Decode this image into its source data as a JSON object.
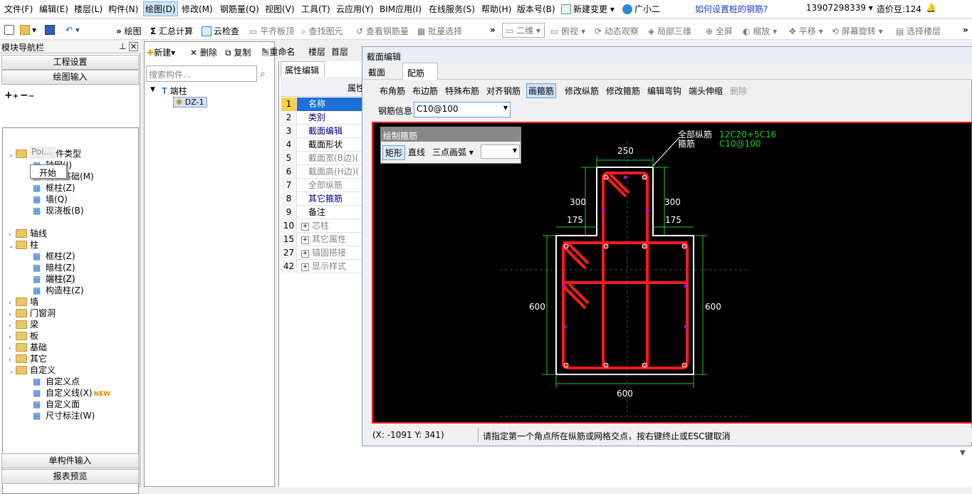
{
  "menu": [
    "文件(F)",
    "编辑(E)",
    "楼层(L)",
    "构件(N)",
    "绘图(D)",
    "修改(M)",
    "钢筋量(Q)",
    "视图(V)",
    "工具(T)",
    "云应用(Y)",
    "BIM应用(I)",
    "在线服务(S)",
    "帮助(H)",
    "版本号(B)",
    "新建变更",
    "广小二"
  ],
  "menu_help_link": "如何设置桩的钢筋?",
  "account": "13907298339",
  "beans": "造价豆:124",
  "toolbar": [
    "绘图",
    "汇总计算",
    "云检查",
    "平齐板顶",
    "查找图元",
    "查看钢筋量",
    "批量选择",
    "二维",
    "俯视",
    "动态观察",
    "局部三维",
    "全屏",
    "缩放",
    "平移",
    "屏幕旋转",
    "选择楼层"
  ],
  "nav": {
    "title": "模块导航栏",
    "btn_top1": "工程设置",
    "btn_top2": "绘图输入",
    "btn_bottom1": "单构件输入",
    "btn_bottom2": "报表预览",
    "tree": [
      {
        "t": "常用构件类型",
        "lvl": 0,
        "folder": true,
        "open": true
      },
      {
        "t": "轴网(J)",
        "lvl": 2
      },
      {
        "t": "筏板基础(M)",
        "lvl": 2
      },
      {
        "t": "框柱(Z)",
        "lvl": 2
      },
      {
        "t": "墙(Q)",
        "lvl": 2
      },
      {
        "t": "现浇板(B)",
        "lvl": 2
      },
      {
        "t": "轴线",
        "lvl": 0,
        "folder": true
      },
      {
        "t": "柱",
        "lvl": 0,
        "folder": true,
        "open": true
      },
      {
        "t": "框柱(Z)",
        "lvl": 2
      },
      {
        "t": "暗柱(Z)",
        "lvl": 2
      },
      {
        "t": "端柱(Z)",
        "lvl": 2,
        "sel": true
      },
      {
        "t": "构造柱(Z)",
        "lvl": 2
      },
      {
        "t": "墙",
        "lvl": 0,
        "folder": true
      },
      {
        "t": "门窗洞",
        "lvl": 0,
        "folder": true
      },
      {
        "t": "梁",
        "lvl": 0,
        "folder": true
      },
      {
        "t": "板",
        "lvl": 0,
        "folder": true
      },
      {
        "t": "基础",
        "lvl": 0,
        "folder": true
      },
      {
        "t": "其它",
        "lvl": 0,
        "folder": true
      },
      {
        "t": "自定义",
        "lvl": 0,
        "folder": true,
        "open": true
      },
      {
        "t": "自定义点",
        "lvl": 2
      },
      {
        "t": "自定义线(X)",
        "lvl": 2
      },
      {
        "t": "自定义面",
        "lvl": 2
      },
      {
        "t": "尺寸标注(W)",
        "lvl": 2
      }
    ],
    "popup_hint": "Poi...",
    "popup_btn": "开始",
    "new_badge": "NEW"
  },
  "mid": {
    "toolbar": [
      "新建",
      "删除",
      "复制",
      "重命名",
      "楼层",
      "首层"
    ],
    "search_placeholder": "搜索构件...",
    "tree_root": "端柱",
    "tree_child": "DZ-1"
  },
  "prop": {
    "tab": "属性编辑",
    "col": "属性",
    "rows": [
      {
        "n": "1",
        "t": "名称",
        "c": "#000080",
        "sel": true
      },
      {
        "n": "2",
        "t": "类别",
        "c": "#000080"
      },
      {
        "n": "3",
        "t": "截面编辑",
        "c": "#000080"
      },
      {
        "n": "4",
        "t": "截面形状",
        "c": "#000"
      },
      {
        "n": "5",
        "t": "截面宽(B边)(",
        "c": "#888"
      },
      {
        "n": "6",
        "t": "截面高(H边)(",
        "c": "#888"
      },
      {
        "n": "7",
        "t": "全部纵筋",
        "c": "#888"
      },
      {
        "n": "8",
        "t": "其它箍筋",
        "c": "#000080"
      },
      {
        "n": "9",
        "t": "备注",
        "c": "#000"
      },
      {
        "n": "10",
        "t": "芯柱",
        "c": "#888",
        "plus": true
      },
      {
        "n": "15",
        "t": "其它属性",
        "c": "#888",
        "plus": true
      },
      {
        "n": "27",
        "t": "锚固搭接",
        "c": "#888",
        "plus": true
      },
      {
        "n": "42",
        "t": "显示样式",
        "c": "#888",
        "plus": true
      }
    ]
  },
  "dialog": {
    "title": "截面编辑",
    "tabs": [
      "截面",
      "配筋"
    ],
    "tools": [
      "布角筋",
      "布边筋",
      "特殊布筋",
      "对齐钢筋",
      "画箍筋",
      "修改纵筋",
      "修改箍筋",
      "编辑弯钩",
      "端头伸缩",
      "删除"
    ],
    "rebar_label": "钢筋信息",
    "rebar_value": "C10@100",
    "draw_title": "绘制箍筋",
    "draw_opts": [
      "矩形",
      "直线",
      "三点画弧"
    ],
    "legend_long_label": "全部纵筋",
    "legend_long_value": "12C20+5C16",
    "legend_stir_label": "箍筋",
    "legend_stir_value": "C10@100",
    "dims": {
      "top": "250",
      "left_upper": "300",
      "right_upper": "300",
      "left_step": "175",
      "right_step": "175",
      "left_side": "600",
      "right_side": "600",
      "bottom": "600"
    },
    "coords": "(X: -1091 Y: 341)",
    "status_msg": "请指定第一个角点所在纵筋或网格交点，按右键终止或ESC键取消"
  },
  "colors": {
    "rebar": "#ff1a1a",
    "dim": "#22cc22",
    "outline": "#ffffff",
    "bg": "#000000",
    "legend": "#22cc22"
  }
}
